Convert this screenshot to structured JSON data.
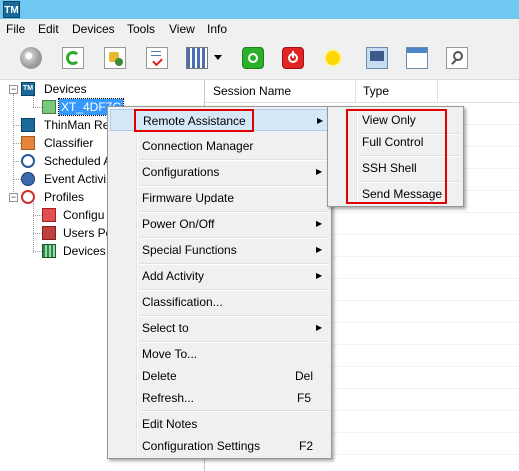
{
  "window": {
    "title_icon_text": "TM"
  },
  "menubar": {
    "items": [
      "File",
      "Edit",
      "Devices",
      "Tools",
      "View",
      "Info"
    ]
  },
  "toolbar": {
    "buttons": [
      "disc-icon",
      "refresh-icon",
      "settings-wand-icon",
      "checklist-icon",
      "grid-icon",
      "dropdown-arrow-icon",
      "power-on-icon",
      "power-off-icon",
      "sun-icon",
      "remote-screen-icon",
      "window-icon",
      "search-icon"
    ]
  },
  "tree": {
    "items": [
      {
        "label": "Devices",
        "icon": "devices-icon"
      },
      {
        "label": "XT_4DF7C",
        "icon": "device-monitor-icon",
        "selected": true
      },
      {
        "label": "ThinMan Re",
        "icon": "thinman-icon"
      },
      {
        "label": "Classifier",
        "icon": "classifier-icon"
      },
      {
        "label": "Scheduled A",
        "icon": "clock-icon"
      },
      {
        "label": "Event Activi",
        "icon": "event-icon"
      },
      {
        "label": "Profiles",
        "icon": "profiles-icon"
      },
      {
        "label": "Configu",
        "icon": "config-profile-icon"
      },
      {
        "label": "Users Po",
        "icon": "users-profile-icon"
      },
      {
        "label": "Devices",
        "icon": "devices-profile-icon"
      }
    ]
  },
  "list": {
    "columns": [
      "Session Name",
      "Type"
    ]
  },
  "context_menu": {
    "items": [
      {
        "label": "Remote Assistance",
        "submenu": true,
        "highlighted": true
      },
      {
        "label": "Connection Manager"
      },
      {
        "label": "Configurations",
        "submenu": true
      },
      {
        "label": "Firmware Update"
      },
      {
        "label": "Power On/Off",
        "submenu": true
      },
      {
        "label": "Special Functions",
        "submenu": true
      },
      {
        "label": "Add Activity",
        "submenu": true
      },
      {
        "label": "Classification..."
      },
      {
        "label": "Select to",
        "submenu": true
      },
      {
        "label": "Move To..."
      },
      {
        "label": "Delete",
        "shortcut": "Del"
      },
      {
        "label": "Refresh...",
        "shortcut": "F5"
      },
      {
        "label": "Edit Notes"
      },
      {
        "label": "Configuration Settings",
        "shortcut": "F2"
      }
    ]
  },
  "submenu": {
    "items": [
      {
        "label": "View Only"
      },
      {
        "label": "Full Control"
      },
      {
        "label": "SSH Shell"
      },
      {
        "label": "Send Message"
      }
    ]
  },
  "colors": {
    "title_bar": "#6ec8f0",
    "highlight_border": "#e00000",
    "menu_hover": "#d5e8f7",
    "selection": "#3399ff"
  }
}
